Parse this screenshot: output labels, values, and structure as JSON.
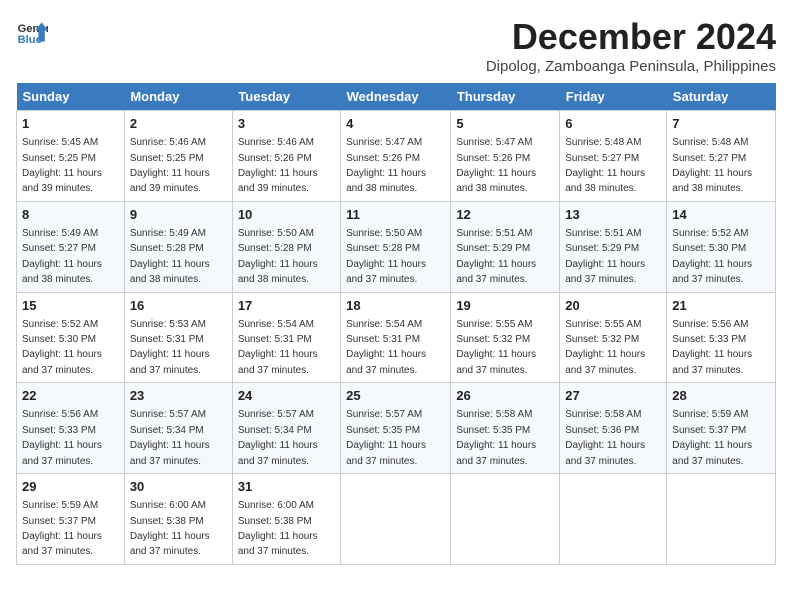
{
  "logo": {
    "line1": "General",
    "line2": "Blue"
  },
  "title": "December 2024",
  "location": "Dipolog, Zamboanga Peninsula, Philippines",
  "days_of_week": [
    "Sunday",
    "Monday",
    "Tuesday",
    "Wednesday",
    "Thursday",
    "Friday",
    "Saturday"
  ],
  "weeks": [
    [
      {
        "day": "1",
        "sunrise": "5:45 AM",
        "sunset": "5:25 PM",
        "daylight": "11 hours and 39 minutes."
      },
      {
        "day": "2",
        "sunrise": "5:46 AM",
        "sunset": "5:25 PM",
        "daylight": "11 hours and 39 minutes."
      },
      {
        "day": "3",
        "sunrise": "5:46 AM",
        "sunset": "5:26 PM",
        "daylight": "11 hours and 39 minutes."
      },
      {
        "day": "4",
        "sunrise": "5:47 AM",
        "sunset": "5:26 PM",
        "daylight": "11 hours and 38 minutes."
      },
      {
        "day": "5",
        "sunrise": "5:47 AM",
        "sunset": "5:26 PM",
        "daylight": "11 hours and 38 minutes."
      },
      {
        "day": "6",
        "sunrise": "5:48 AM",
        "sunset": "5:27 PM",
        "daylight": "11 hours and 38 minutes."
      },
      {
        "day": "7",
        "sunrise": "5:48 AM",
        "sunset": "5:27 PM",
        "daylight": "11 hours and 38 minutes."
      }
    ],
    [
      {
        "day": "8",
        "sunrise": "5:49 AM",
        "sunset": "5:27 PM",
        "daylight": "11 hours and 38 minutes."
      },
      {
        "day": "9",
        "sunrise": "5:49 AM",
        "sunset": "5:28 PM",
        "daylight": "11 hours and 38 minutes."
      },
      {
        "day": "10",
        "sunrise": "5:50 AM",
        "sunset": "5:28 PM",
        "daylight": "11 hours and 38 minutes."
      },
      {
        "day": "11",
        "sunrise": "5:50 AM",
        "sunset": "5:28 PM",
        "daylight": "11 hours and 37 minutes."
      },
      {
        "day": "12",
        "sunrise": "5:51 AM",
        "sunset": "5:29 PM",
        "daylight": "11 hours and 37 minutes."
      },
      {
        "day": "13",
        "sunrise": "5:51 AM",
        "sunset": "5:29 PM",
        "daylight": "11 hours and 37 minutes."
      },
      {
        "day": "14",
        "sunrise": "5:52 AM",
        "sunset": "5:30 PM",
        "daylight": "11 hours and 37 minutes."
      }
    ],
    [
      {
        "day": "15",
        "sunrise": "5:52 AM",
        "sunset": "5:30 PM",
        "daylight": "11 hours and 37 minutes."
      },
      {
        "day": "16",
        "sunrise": "5:53 AM",
        "sunset": "5:31 PM",
        "daylight": "11 hours and 37 minutes."
      },
      {
        "day": "17",
        "sunrise": "5:54 AM",
        "sunset": "5:31 PM",
        "daylight": "11 hours and 37 minutes."
      },
      {
        "day": "18",
        "sunrise": "5:54 AM",
        "sunset": "5:31 PM",
        "daylight": "11 hours and 37 minutes."
      },
      {
        "day": "19",
        "sunrise": "5:55 AM",
        "sunset": "5:32 PM",
        "daylight": "11 hours and 37 minutes."
      },
      {
        "day": "20",
        "sunrise": "5:55 AM",
        "sunset": "5:32 PM",
        "daylight": "11 hours and 37 minutes."
      },
      {
        "day": "21",
        "sunrise": "5:56 AM",
        "sunset": "5:33 PM",
        "daylight": "11 hours and 37 minutes."
      }
    ],
    [
      {
        "day": "22",
        "sunrise": "5:56 AM",
        "sunset": "5:33 PM",
        "daylight": "11 hours and 37 minutes."
      },
      {
        "day": "23",
        "sunrise": "5:57 AM",
        "sunset": "5:34 PM",
        "daylight": "11 hours and 37 minutes."
      },
      {
        "day": "24",
        "sunrise": "5:57 AM",
        "sunset": "5:34 PM",
        "daylight": "11 hours and 37 minutes."
      },
      {
        "day": "25",
        "sunrise": "5:57 AM",
        "sunset": "5:35 PM",
        "daylight": "11 hours and 37 minutes."
      },
      {
        "day": "26",
        "sunrise": "5:58 AM",
        "sunset": "5:35 PM",
        "daylight": "11 hours and 37 minutes."
      },
      {
        "day": "27",
        "sunrise": "5:58 AM",
        "sunset": "5:36 PM",
        "daylight": "11 hours and 37 minutes."
      },
      {
        "day": "28",
        "sunrise": "5:59 AM",
        "sunset": "5:37 PM",
        "daylight": "11 hours and 37 minutes."
      }
    ],
    [
      {
        "day": "29",
        "sunrise": "5:59 AM",
        "sunset": "5:37 PM",
        "daylight": "11 hours and 37 minutes."
      },
      {
        "day": "30",
        "sunrise": "6:00 AM",
        "sunset": "5:38 PM",
        "daylight": "11 hours and 37 minutes."
      },
      {
        "day": "31",
        "sunrise": "6:00 AM",
        "sunset": "5:38 PM",
        "daylight": "11 hours and 37 minutes."
      },
      null,
      null,
      null,
      null
    ]
  ]
}
